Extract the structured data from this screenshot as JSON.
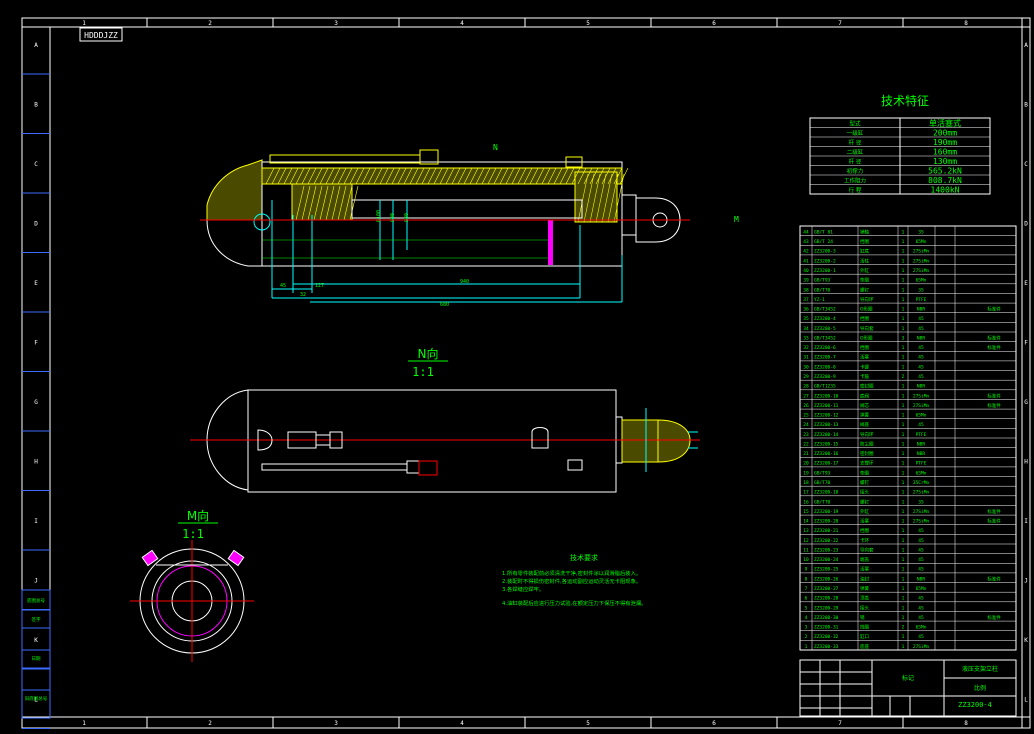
{
  "colors": {
    "background": "#000000",
    "frame": "#ffffff",
    "accent_green": "#00ff00",
    "centerline_red": "#ff0000",
    "hatch_yellow": "#ffff00",
    "dim_cyan": "#00ffff",
    "ring_magenta": "#ff00ff",
    "frame_blue": "#3b6cff"
  },
  "border": {
    "columns": [
      "1",
      "2",
      "3",
      "4",
      "5",
      "6",
      "7",
      "8"
    ],
    "rows": [
      "A",
      "B",
      "C",
      "D",
      "E",
      "F",
      "G",
      "H",
      "I",
      "J",
      "K",
      "L"
    ],
    "drawing_code_box": "HDDDJZZ"
  },
  "main_view": {
    "direction_marker": "N",
    "right_marker": "M",
    "dimensions": [
      "45",
      "127",
      "32",
      "940",
      "680",
      "Ø100",
      "Ø90",
      "Ø80"
    ]
  },
  "section_n": {
    "label": "N向",
    "scale": "1:1"
  },
  "section_m": {
    "label": "M向",
    "scale": "1:1"
  },
  "tech_specs": {
    "title": "技术特征",
    "rows": [
      {
        "name": "型式",
        "value": "单活塞式"
      },
      {
        "name": "一级缸",
        "value": "200mm"
      },
      {
        "name": "杆 径",
        "value": "190mm"
      },
      {
        "name": "二级缸",
        "value": "160mm"
      },
      {
        "name": "杆 径",
        "value": "130mm"
      },
      {
        "name": "初撑力",
        "value": "565.2kN"
      },
      {
        "name": "工作阻力",
        "value": "808.7kN"
      },
      {
        "name": "行 程",
        "value": "1400kN"
      }
    ]
  },
  "notes": {
    "title": "技术要求",
    "lines": [
      "1.所有零件装配前必须清洗干净,密封件涂以润滑脂后装入。",
      "2.装配时不得损伤密封件,各运动副应运动灵活无卡阻现象。",
      "3.各焊缝应焊牢。",
      "4.油缸装配后应进行压力试验,在额定压力下保压不得有泄漏。"
    ]
  },
  "bom": {
    "rows": [
      {
        "no": "44",
        "code": "GB/T 81",
        "name": "销轴",
        "qty": "1",
        "mat": "35",
        "note": ""
      },
      {
        "no": "43",
        "code": "GB/T 24",
        "name": "挡圈",
        "qty": "1",
        "mat": "65Mn",
        "note": ""
      },
      {
        "no": "42",
        "code": "ZZ3200-3",
        "name": "缸底",
        "qty": "1",
        "mat": "27SiMn",
        "note": ""
      },
      {
        "no": "41",
        "code": "ZZ3200-2",
        "name": "活柱",
        "qty": "1",
        "mat": "27SiMn",
        "note": ""
      },
      {
        "no": "40",
        "code": "ZZ3200-1",
        "name": "外缸",
        "qty": "1",
        "mat": "27SiMn",
        "note": ""
      },
      {
        "no": "39",
        "code": "GB/T93",
        "name": "垫圈",
        "qty": "1",
        "mat": "65Mn",
        "note": ""
      },
      {
        "no": "38",
        "code": "GB/T70",
        "name": "螺钉",
        "qty": "1",
        "mat": "35",
        "note": ""
      },
      {
        "no": "37",
        "code": "YZ-1",
        "name": "导向环",
        "qty": "1",
        "mat": "PTFE",
        "note": ""
      },
      {
        "no": "36",
        "code": "GB/T3452",
        "name": "O形圈",
        "qty": "1",
        "mat": "NBR",
        "note": "标准件"
      },
      {
        "no": "35",
        "code": "ZZ3200-4",
        "name": "挡圈",
        "qty": "1",
        "mat": "45",
        "note": ""
      },
      {
        "no": "34",
        "code": "ZZ3200-5",
        "name": "导向套",
        "qty": "1",
        "mat": "45",
        "note": ""
      },
      {
        "no": "33",
        "code": "GB/T3452",
        "name": "O形圈",
        "qty": "3",
        "mat": "NBR",
        "note": "标准件"
      },
      {
        "no": "32",
        "code": "ZZ3200-6",
        "name": "挡圈",
        "qty": "1",
        "mat": "45",
        "note": "标准件"
      },
      {
        "no": "31",
        "code": "ZZ3200-7",
        "name": "活塞",
        "qty": "1",
        "mat": "45",
        "note": ""
      },
      {
        "no": "30",
        "code": "ZZ3200-8",
        "name": "卡键",
        "qty": "1",
        "mat": "45",
        "note": ""
      },
      {
        "no": "29",
        "code": "ZZ3200-9",
        "name": "卡箍",
        "qty": "2",
        "mat": "45",
        "note": ""
      },
      {
        "no": "28",
        "code": "GB/T1235",
        "name": "密封圈",
        "qty": "1",
        "mat": "NBR",
        "note": ""
      },
      {
        "no": "27",
        "code": "ZZ3200-10",
        "name": "底阀",
        "qty": "1",
        "mat": "27SiMn",
        "note": "标准件"
      },
      {
        "no": "26",
        "code": "ZZ3200-11",
        "name": "阀芯",
        "qty": "1",
        "mat": "27SiMn",
        "note": "标准件"
      },
      {
        "no": "25",
        "code": "ZZ3200-12",
        "name": "弹簧",
        "qty": "1",
        "mat": "65Mn",
        "note": ""
      },
      {
        "no": "24",
        "code": "ZZ3200-13",
        "name": "阀座",
        "qty": "1",
        "mat": "45",
        "note": ""
      },
      {
        "no": "23",
        "code": "ZZ3200-14",
        "name": "导向环",
        "qty": "1",
        "mat": "PTFE",
        "note": ""
      },
      {
        "no": "22",
        "code": "ZZ3200-15",
        "name": "防尘圈",
        "qty": "1",
        "mat": "NBR",
        "note": ""
      },
      {
        "no": "21",
        "code": "ZZ3200-16",
        "name": "密封圈",
        "qty": "1",
        "mat": "NBR",
        "note": ""
      },
      {
        "no": "20",
        "code": "ZZ3200-17",
        "name": "支撑环",
        "qty": "1",
        "mat": "PTFE",
        "note": ""
      },
      {
        "no": "19",
        "code": "GB/T93",
        "name": "垫圈",
        "qty": "1",
        "mat": "65Mn",
        "note": ""
      },
      {
        "no": "18",
        "code": "GB/T70",
        "name": "螺钉",
        "qty": "1",
        "mat": "35CrMo",
        "note": ""
      },
      {
        "no": "17",
        "code": "ZZ3200-18",
        "name": "接头",
        "qty": "1",
        "mat": "27SiMn",
        "note": ""
      },
      {
        "no": "16",
        "code": "GB/T70",
        "name": "螺钉",
        "qty": "1",
        "mat": "35",
        "note": ""
      },
      {
        "no": "15",
        "code": "ZZ3200-19",
        "name": "外缸",
        "qty": "1",
        "mat": "27SiMn",
        "note": "标准件"
      },
      {
        "no": "14",
        "code": "ZZ3200-20",
        "name": "活塞",
        "qty": "1",
        "mat": "27SiMn",
        "note": "标准件"
      },
      {
        "no": "13",
        "code": "ZZ3200-21",
        "name": "挡圈",
        "qty": "1",
        "mat": "45",
        "note": ""
      },
      {
        "no": "12",
        "code": "ZZ3200-22",
        "name": "卡环",
        "qty": "1",
        "mat": "45",
        "note": ""
      },
      {
        "no": "11",
        "code": "ZZ3200-23",
        "name": "导向套",
        "qty": "1",
        "mat": "45",
        "note": ""
      },
      {
        "no": "10",
        "code": "ZZ3200-24",
        "name": "端盖",
        "qty": "1",
        "mat": "45",
        "note": ""
      },
      {
        "no": "9",
        "code": "ZZ3200-25",
        "name": "活塞",
        "qty": "1",
        "mat": "45",
        "note": ""
      },
      {
        "no": "8",
        "code": "ZZ3200-26",
        "name": "油封",
        "qty": "1",
        "mat": "NBR",
        "note": "标准件"
      },
      {
        "no": "7",
        "code": "ZZ3200-27",
        "name": "弹簧",
        "qty": "1",
        "mat": "65Mn",
        "note": ""
      },
      {
        "no": "6",
        "code": "ZZ3200-28",
        "name": "顶盖",
        "qty": "1",
        "mat": "45",
        "note": ""
      },
      {
        "no": "5",
        "code": "ZZ3200-29",
        "name": "接头",
        "qty": "1",
        "mat": "45",
        "note": ""
      },
      {
        "no": "4",
        "code": "ZZ3200-30",
        "name": "销",
        "qty": "1",
        "mat": "45",
        "note": "标准件"
      },
      {
        "no": "3",
        "code": "ZZ3200-31",
        "name": "挡圈",
        "qty": "2",
        "mat": "65Mn",
        "note": ""
      },
      {
        "no": "2",
        "code": "ZZ3200-32",
        "name": "缸口",
        "qty": "1",
        "mat": "45",
        "note": ""
      },
      {
        "no": "1",
        "code": "ZZ3200-33",
        "name": "底座",
        "qty": "1",
        "mat": "27SiMn",
        "note": ""
      }
    ]
  },
  "title_block": {
    "assembly": "液压支架立柱",
    "label_left": "标记",
    "label_mid": "比例",
    "drawing_no": "ZZ3200-4"
  },
  "left_panel": {
    "items": [
      "底图总号",
      "签字",
      "日期",
      "旧底图总号"
    ]
  }
}
